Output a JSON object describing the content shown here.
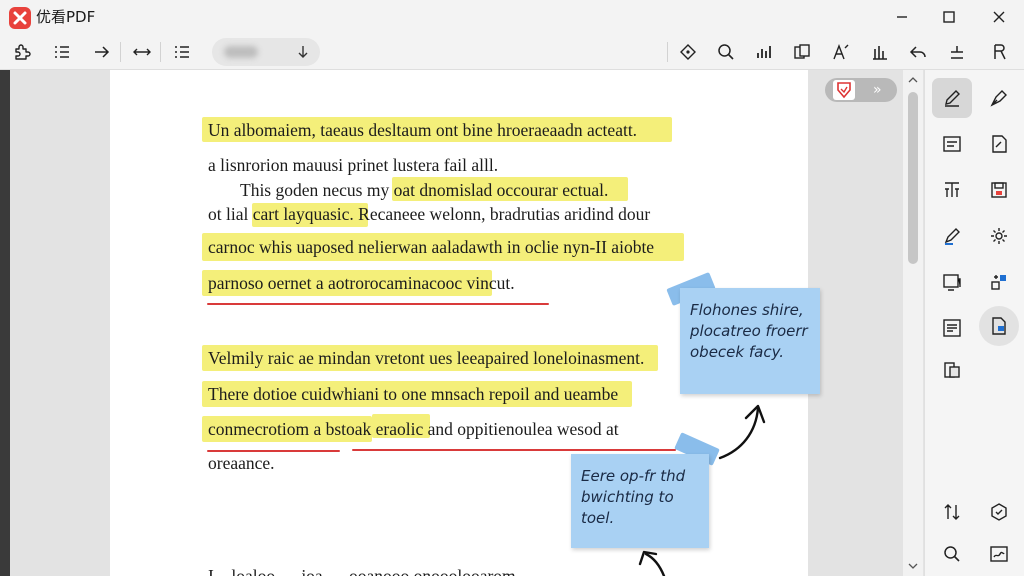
{
  "app": {
    "title": "优看PDF"
  },
  "document": {
    "lines": [
      "Un albomaiem, taeaus desltaum ont bine hroeraeaadn acteatt.",
      "a lisnrorion mauusi prinet lustera fail alll.",
      "This goden necus my oat dnomislad occourar ectual.",
      "ot lial cart layquasic. Recaneee welonn, bradrutias aridind dour",
      "carnoc whis uaposed nelierwan aaladawth in oclie nyn-II aiobte",
      "parnoso oernet a aotrorocaminacooc vincut.",
      "Velmily raic ae mindan vretont ues leeapaired loneloinasment.",
      "There dotioe cuidwhiani to one mnsach repoil and ueambe",
      "conmecrotiom a bstoak eraolic and oppitienoulea wesod at",
      "oreaance."
    ],
    "bottom_text": "I    loaloo      ioa      ooanooo  onooolooarom"
  },
  "sticky_notes": [
    {
      "lines": [
        "Flohones shire,",
        "plocatreo froerr",
        "obecek facy."
      ]
    },
    {
      "lines": [
        "Eere op-fr thd",
        "bwichting to toel."
      ]
    }
  ],
  "colors": {
    "highlight": "#f4ef7a",
    "underline": "#d93a3a",
    "sticky": "#a9d1f3",
    "accent": "#e8423c"
  }
}
